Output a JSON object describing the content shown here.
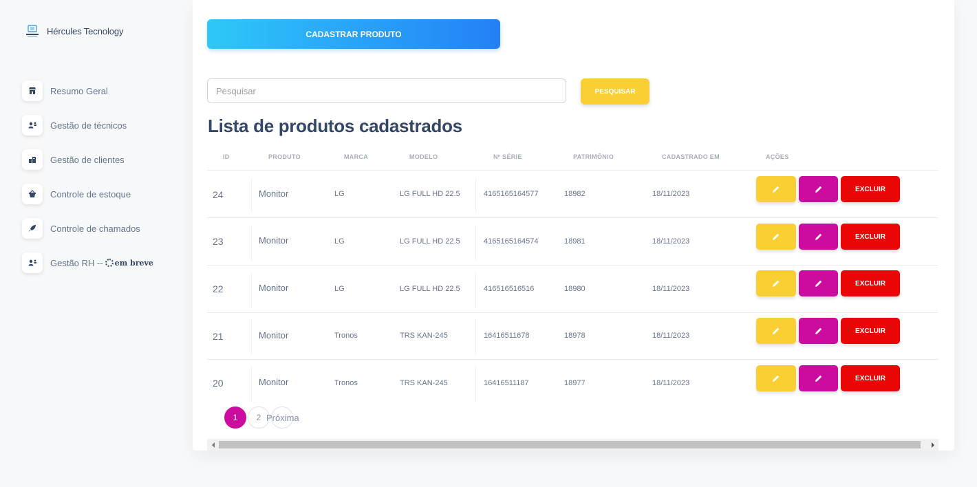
{
  "sidebar": {
    "brand": "Hércules Tecnology",
    "items": [
      {
        "label": "Resumo Geral",
        "icon": "store-icon"
      },
      {
        "label": "Gestão de técnicos",
        "icon": "users-icon"
      },
      {
        "label": "Gestão de clientes",
        "icon": "office-icon"
      },
      {
        "label": "Controle de estoque",
        "icon": "basket-icon"
      },
      {
        "label": "Controle de chamados",
        "icon": "rocket-icon"
      },
      {
        "label": "Gestão RH -- ",
        "icon": "users-icon"
      }
    ],
    "soon": "em breve"
  },
  "actions": {
    "register_label": "CADASTRAR PRODUTO",
    "search_placeholder": "Pesquisar",
    "search_button": "PESQUISAR"
  },
  "list": {
    "title": "Lista de produtos cadastrados",
    "columns": [
      "ID",
      "PRODUTO",
      "MARCA",
      "MODELO",
      "Nº SÉRIE",
      "PATRIMÔNIO",
      "CADASTRADO EM",
      "AÇÕES"
    ],
    "delete_label": "EXCLUIR",
    "rows": [
      {
        "id": "24",
        "produto": "Monitor",
        "marca": "LG",
        "modelo": "LG FULL HD 22.5",
        "serie": "4165165164577",
        "patrimonio": "18982",
        "data": "18/11/2023"
      },
      {
        "id": "23",
        "produto": "Monitor",
        "marca": "LG",
        "modelo": "LG FULL HD 22.5",
        "serie": "4165165164574",
        "patrimonio": "18981",
        "data": "18/11/2023"
      },
      {
        "id": "22",
        "produto": "Monitor",
        "marca": "LG",
        "modelo": "LG FULL HD 22.5",
        "serie": "416516516516",
        "patrimonio": "18980",
        "data": "18/11/2023"
      },
      {
        "id": "21",
        "produto": "Monitor",
        "marca": "Tronos",
        "modelo": "TRS KAN-245",
        "serie": "16416511678",
        "patrimonio": "18978",
        "data": "18/11/2023"
      },
      {
        "id": "20",
        "produto": "Monitor",
        "marca": "Tronos",
        "modelo": "TRS KAN-245",
        "serie": "16416511187",
        "patrimonio": "18977",
        "data": "18/11/2023"
      }
    ]
  },
  "pagination": {
    "pages": [
      "1",
      "2"
    ],
    "current": "1",
    "next": "Próxima"
  },
  "colors": {
    "primary_gradient_start": "#2ec8f8",
    "primary_gradient_end": "#2380f7",
    "warning": "#fbcf33",
    "accent": "#cb0c9f",
    "danger": "#ea0606"
  }
}
